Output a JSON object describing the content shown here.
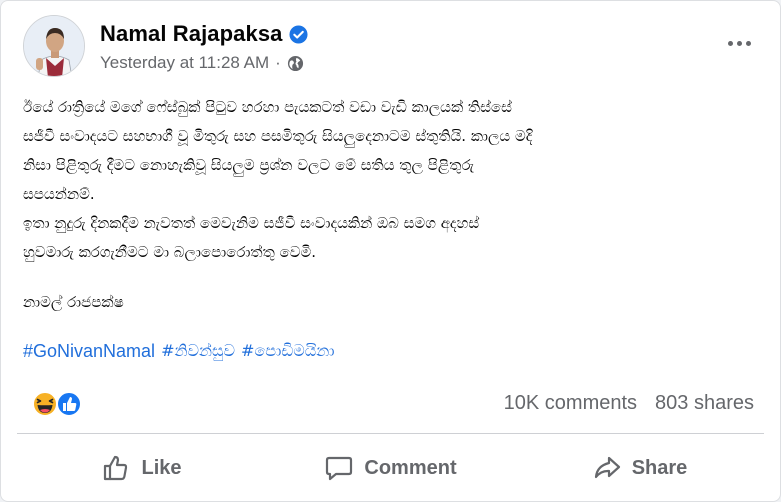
{
  "post": {
    "author": "Namal Rajapaksa",
    "timestamp": "Yesterday at 11:28 AM",
    "separator": "·",
    "audience_icon": "globe-icon",
    "verified_icon": "verified-badge-icon",
    "body_lines": [
      "ඊයේ රාත්‍රියේ මගේ ෆේස්බුක් පිටුව හරහා පැයකටත් වඩා වැඩි කාලයක් තිස්සේ",
      "සජීවී සංවාදයට සහභාගී වූ මිතුරු සහ පසමිතුරු සියලුදෙනාටම ස්තුතියි. කාලය මදි",
      "නිසා පිළිතුරු දීමට නොහැකිවූ සියලුම ප්‍රශ්න වලට මේ සතිය තුල පිළිතුරු",
      "සපයන්නම්.",
      "ඉතා නුදුරු දිනකදීම නැවතත් මෙවැනිම සජීවී සංවාදයකින් ඔබ සමග අදහස්",
      "හුවමාරු කරගැනීමට මා බලාපොරොත්තු වෙමි."
    ],
    "signature": "නාමල් රාජපක්ෂ",
    "hashtags": [
      "#GoNivanNamal",
      "#නිවන්සුව",
      "#පොඩිමයිනා"
    ],
    "reactions": [
      "haha-icon",
      "like-icon"
    ],
    "comments_count": "10K comments",
    "shares_count": "803 shares"
  },
  "actions": {
    "like": "Like",
    "comment": "Comment",
    "share": "Share"
  },
  "colors": {
    "link": "#216fdb",
    "secondary_text": "#65676b",
    "verified": "#1b74e4",
    "like_blue": "#1877f2",
    "haha_yellow": "#f7b125"
  }
}
